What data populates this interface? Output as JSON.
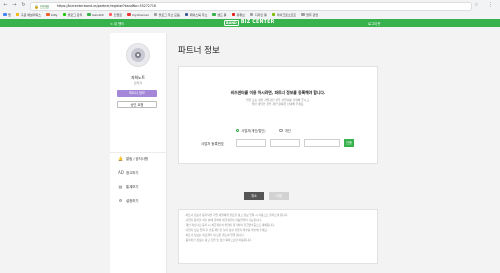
{
  "browser": {
    "secure_label": "안전함",
    "url": "https://bizcenter.band.us/partner/register?bandNo=55272716",
    "bookmarks": [
      {
        "label": "앱",
        "color": "#4285f4"
      },
      {
        "label": "구글 애널리틱스",
        "color": "#f4b400"
      },
      {
        "label": "bitly",
        "color": "#ee6123"
      },
      {
        "label": "불로그 관리",
        "color": "#1ec800"
      },
      {
        "label": "band24",
        "color": "#37b24d"
      },
      {
        "label": "킨클로",
        "color": "#ff5a5f"
      },
      {
        "label": "mychannel",
        "color": "#e53935"
      },
      {
        "label": "블로그 주소 모음",
        "color": "#9e9e9e"
      },
      {
        "label": "페이스북 주소",
        "color": "#3b5998"
      },
      {
        "label": "밴드 툴",
        "color": "#37b24d"
      },
      {
        "label": "유튜브",
        "color": "#e62117"
      },
      {
        "label": "디자인 툴",
        "color": "#9e9e9e"
      },
      {
        "label": "마이크로소프트",
        "color": "#7cbb00"
      },
      {
        "label": "업무 관련",
        "color": "#9e9e9e"
      }
    ]
  },
  "header": {
    "left_label": "< 내 밴드",
    "logo_badge": "BAND",
    "logo_title": "BIZ CENTER",
    "right_label": "로그아웃"
  },
  "sidebar": {
    "profile_name": "저희노트",
    "profile_role": "관리자",
    "partner_info_button": "파트너 정보",
    "switch_button": "승인 요청",
    "nav": [
      {
        "label": "알림 / 공지사항",
        "icon": "bell-icon",
        "glyph": "🔔",
        "name": "sidebar-item-notice"
      },
      {
        "label": "광고하기",
        "icon": "ad-icon",
        "glyph": "AD",
        "name": "sidebar-item-ads"
      },
      {
        "label": "통계보기",
        "icon": "chart-icon",
        "glyph": "▤",
        "name": "sidebar-item-stats"
      },
      {
        "label": "설정하기",
        "icon": "gear-icon",
        "glyph": "⚙",
        "name": "sidebar-item-settings"
      }
    ]
  },
  "main": {
    "title": "파트너 정보",
    "heading": "비즈센터를 이용 하시려면, 파트너 정보를 등록해야 합니다.",
    "desc1": "법인 또는 개인 사업자인 경우 사업자를 선택해 주시고,",
    "desc2": "일반 개인인 경우 개인 항목을 선택해 주세요.",
    "radio_business": "사업자(개인/법인)",
    "radio_personal": "개인",
    "reg_label": "사업자 등록번호",
    "reg_button": "인증",
    "cancel_button": "취소",
    "next_button": "다음"
  },
  "notice": [
    "· 파트너 정보가 등록되면 기업 회원에게 필요한 광고 정보 입력 시 자동으로 불러오게 됩니다.",
    "· 사업자 등록을 하신 분에 한하여 세금계산서 자동발행이 가능합니다.",
    "· 개인 파트너로 등록 시 세금계산서 발행이 불가하며 현금영수증으로 대체됩니다.",
    "· 사업자 정보 입력 후 인증 버튼을 눌러 정상 사업자 여부를 확인해 주세요.",
    "· 파트너 정보는 비즈센터 내 모든 밴드와 연결 됩니다.",
    "· 등록하신 정보는 광고 집행 및 정산 목적으로만 이용됩니다."
  ]
}
